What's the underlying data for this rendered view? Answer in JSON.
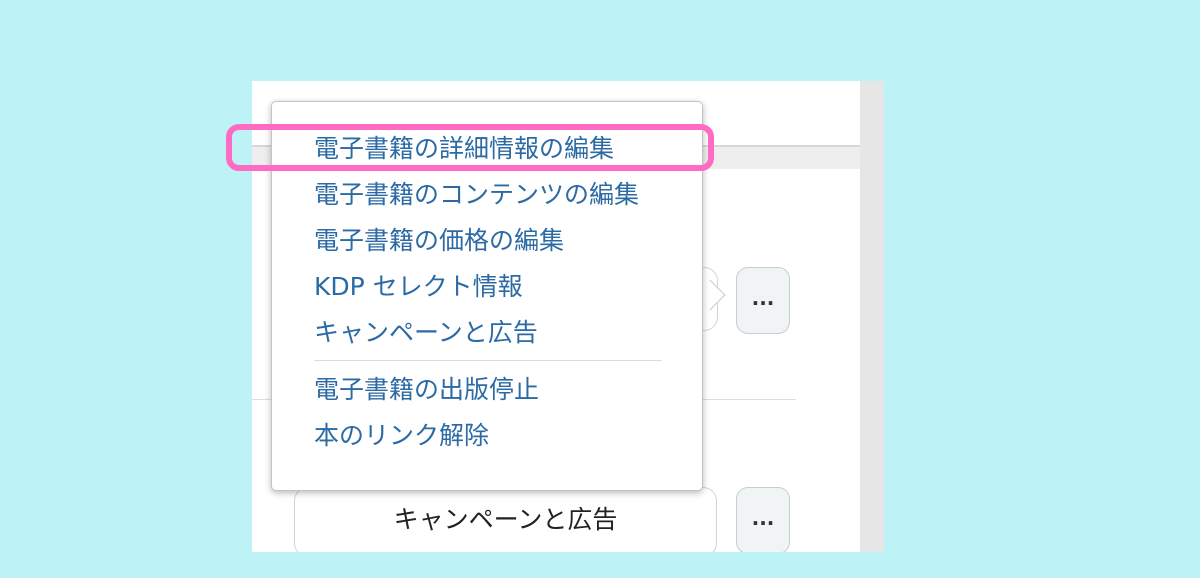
{
  "menu": {
    "items": [
      {
        "label": "電子書籍の詳細情報の編集"
      },
      {
        "label": "電子書籍のコンテンツの編集"
      },
      {
        "label": "電子書籍の価格の編集"
      },
      {
        "label": "KDP セレクト情報"
      },
      {
        "label": "キャンペーンと広告"
      }
    ],
    "secondary_items": [
      {
        "label": "電子書籍の出版停止"
      },
      {
        "label": "本のリンク解除"
      }
    ]
  },
  "buttons": {
    "more_label": "...",
    "campaign_label": "キャンペーンと広告"
  },
  "colors": {
    "background": "#bdf3f6",
    "link": "#2b6aa4",
    "highlight": "#ff6ac2"
  }
}
